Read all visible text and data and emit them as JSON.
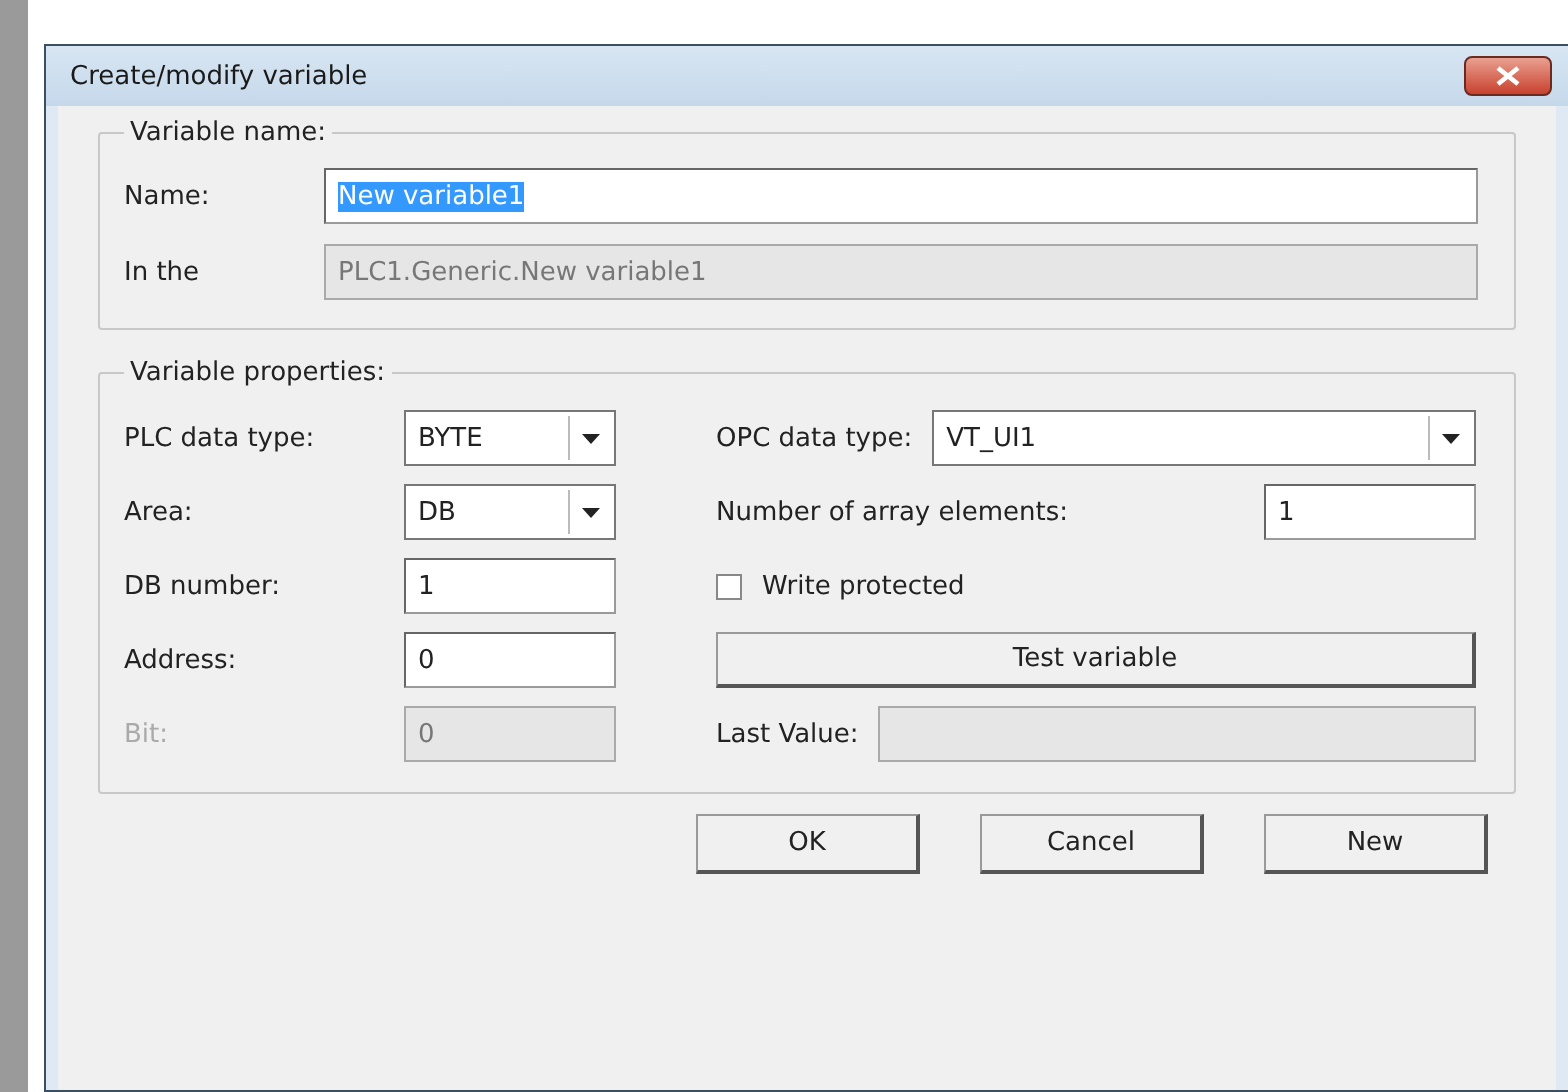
{
  "window": {
    "title": "Create/modify variable"
  },
  "variable_name": {
    "title": "Variable name:",
    "fields": [
      {
        "label": "Name:",
        "value": "New variable1",
        "text_selected": true,
        "disabled": false
      },
      {
        "label": "In the",
        "value": "PLC1.Generic.New variable1",
        "text_selected": false,
        "disabled": true
      }
    ]
  },
  "variable_properties": {
    "title": "Variable properties:",
    "left": [
      {
        "kind": "combo",
        "label": "PLC data type:",
        "value": "BYTE",
        "disabled": false
      },
      {
        "kind": "combo",
        "label": "Area:",
        "value": "DB",
        "disabled": false
      },
      {
        "kind": "field",
        "label": "DB number:",
        "value": "1",
        "disabled": false
      },
      {
        "kind": "field",
        "label": "Address:",
        "value": "0",
        "disabled": false
      },
      {
        "kind": "field",
        "label": "Bit:",
        "value": "0",
        "disabled": true
      }
    ],
    "right": [
      {
        "kind": "combo",
        "label": "OPC data type:",
        "value": "VT_UI1",
        "disabled": false
      },
      {
        "kind": "field",
        "label": "Number of array elements:",
        "value": "1",
        "disabled": false
      },
      {
        "kind": "checkbox",
        "label": "Write protected",
        "checked": false
      },
      {
        "kind": "button",
        "label": "Test variable"
      },
      {
        "kind": "field",
        "label": "Last Value:",
        "disabled": true
      }
    ]
  },
  "buttons": [
    "OK",
    "Cancel",
    "New"
  ]
}
